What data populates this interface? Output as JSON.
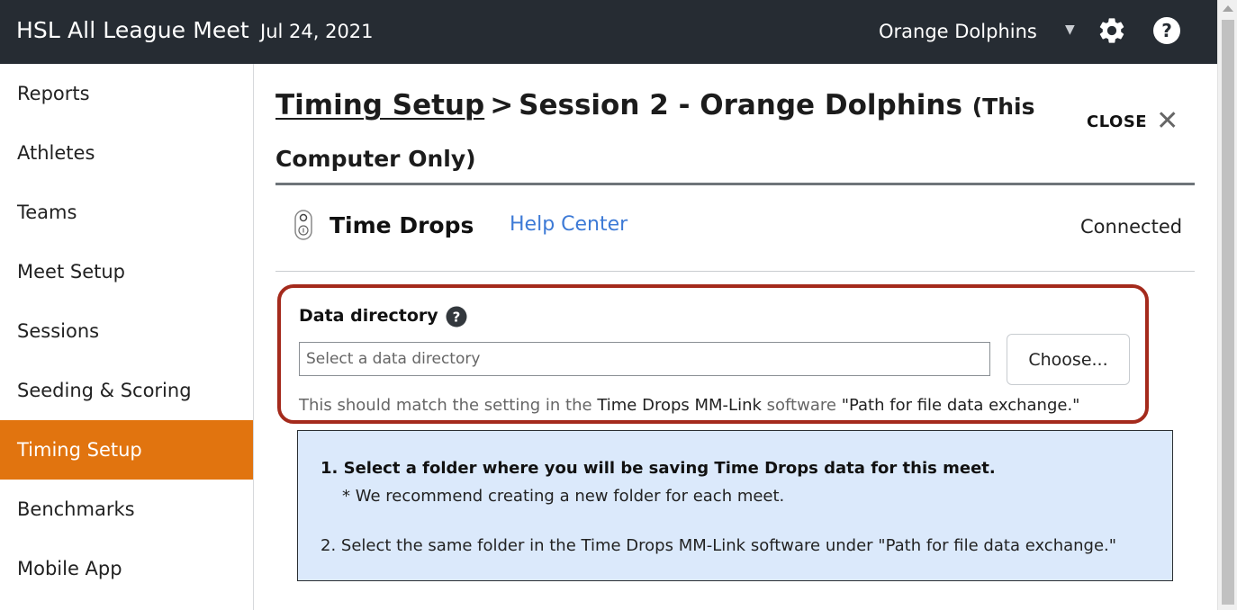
{
  "header": {
    "app_title": "HSL All League Meet",
    "meet_date": "Jul 24, 2021",
    "team": "Orange Dolphins"
  },
  "sidebar": {
    "items": [
      {
        "label": "Reports"
      },
      {
        "label": "Athletes"
      },
      {
        "label": "Teams"
      },
      {
        "label": "Meet Setup"
      },
      {
        "label": "Sessions"
      },
      {
        "label": "Seeding & Scoring"
      },
      {
        "label": "Timing Setup",
        "active": true
      },
      {
        "label": "Benchmarks"
      },
      {
        "label": "Mobile App"
      }
    ]
  },
  "page": {
    "breadcrumb_link": "Timing Setup",
    "breadcrumb_sep": ">",
    "session_title": "Session 2 - Orange Dolphins",
    "scope_note": "(This Computer Only)",
    "close_label": "CLOSE"
  },
  "device": {
    "name": "Time Drops",
    "help_link": "Help Center",
    "status": "Connected"
  },
  "data_directory": {
    "label": "Data directory",
    "placeholder": "Select a data directory",
    "value": "",
    "choose_label": "Choose...",
    "hint_prefix": "This should match the setting in the",
    "hint_software": "Time Drops MM-Link",
    "hint_middle": "software",
    "hint_setting": "\"Path for file data exchange.\""
  },
  "instructions": {
    "step1": "1. Select a folder where you will be saving Time Drops data for this meet.",
    "step1_note": "* We recommend creating a new folder for each meet.",
    "step2": "2. Select the same folder in the Time Drops MM-Link software under \"Path for file data exchange.\""
  },
  "colors": {
    "topbar_bg": "#262c33",
    "active_nav": "#e1740f",
    "link": "#3d7ad6",
    "highlight_border": "#a42a1c",
    "info_bg": "#dbe9fb"
  },
  "icons": {
    "settings": "gear-icon",
    "help": "question-circle-icon",
    "device": "time-drops-device-icon",
    "close": "close-icon",
    "dropdown": "caret-down-icon"
  }
}
